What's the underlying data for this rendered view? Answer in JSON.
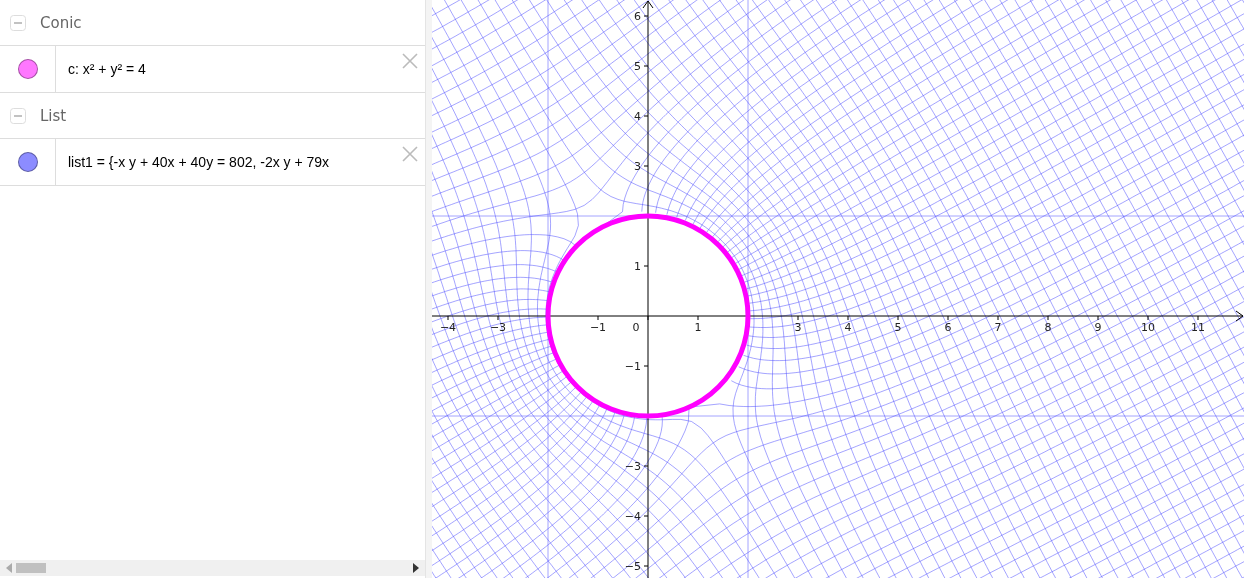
{
  "algebra": {
    "groups": [
      {
        "label": "Conic",
        "expanded": true,
        "items": [
          {
            "text": "c: x² + y² = 4",
            "color": "#ff77ff"
          }
        ]
      },
      {
        "label": "List",
        "expanded": true,
        "items": [
          {
            "text": "list1 = {-x y + 40x + 40y = 802, -2x y + 79x",
            "color": "#8c8cff"
          }
        ]
      }
    ]
  },
  "graphics": {
    "x_tick_labels": [
      "−4",
      "−3",
      "−1",
      "0",
      "1",
      "3",
      "4",
      "5",
      "6",
      "7",
      "8",
      "9",
      "10",
      "11"
    ],
    "y_tick_labels": [
      "6",
      "5",
      "4",
      "3",
      "1",
      "−1",
      "−3",
      "−4",
      "−5"
    ]
  }
}
